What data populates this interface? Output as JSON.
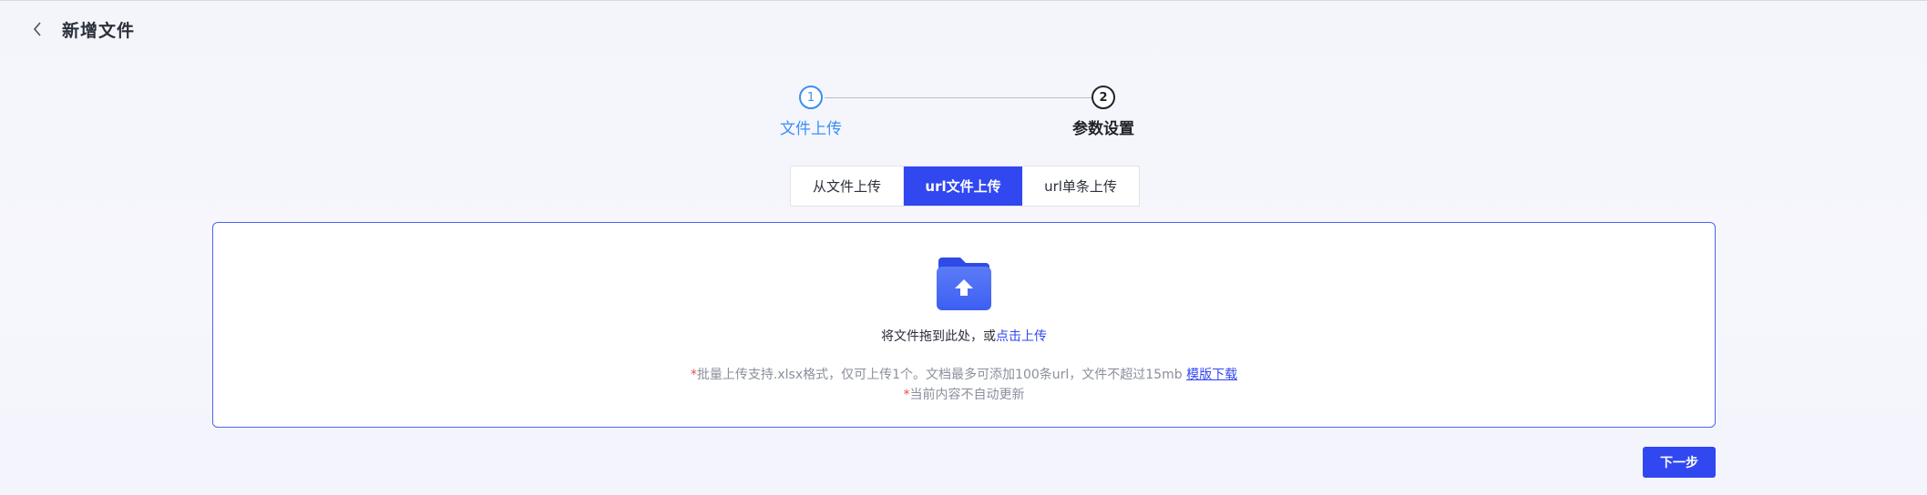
{
  "header": {
    "back_icon": "chevron-left-icon",
    "title": "新增文件"
  },
  "steps": [
    {
      "number": "1",
      "label": "文件上传",
      "state": "active",
      "color": "#3a8df5"
    },
    {
      "number": "2",
      "label": "参数设置",
      "state": "pending",
      "color": "#1f2329"
    }
  ],
  "tabs": [
    {
      "label": "从文件上传",
      "selected": false
    },
    {
      "label": "url文件上传",
      "selected": true
    },
    {
      "label": "url单条上传",
      "selected": false
    }
  ],
  "upload": {
    "icon": "folder-upload-icon",
    "drop_text": "将文件拖到此处，或",
    "drop_link": "点击上传",
    "note_1_star": "*",
    "note_1": "批量上传支持.xlsx格式，仅可上传1个。文档最多可添加100条url，文件不超过15mb",
    "template_link": "模版下载",
    "note_2_star": "*",
    "note_2": "当前内容不自动更新"
  },
  "actions": {
    "next_label": "下一步"
  },
  "colors": {
    "accent": "#3147f0",
    "step_active": "#3a8df5",
    "required_star": "#e34d4d"
  }
}
